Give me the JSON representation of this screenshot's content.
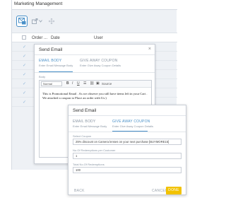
{
  "background": {
    "title": "Marketing Management",
    "table": {
      "columns": [
        "Order ...",
        "Date",
        "User"
      ]
    },
    "row_count": 7
  },
  "dialog1": {
    "title": "Send Email",
    "close": "×",
    "tabs": [
      {
        "label": "EMAIL BODY",
        "sub": "Enter Email Message Body",
        "active": true
      },
      {
        "label": "GIVE AWAY COUPON",
        "sub": "Enter Give Away Coupon Details",
        "active": false
      }
    ],
    "body_label": "Body",
    "editor": {
      "font": "Normal",
      "bold": "B",
      "italic": "I",
      "underline": "U",
      "source": "Source",
      "content": "This is Promotional Email . As we observe you still have items left in your  Cart . We attached a coupon to Place an order with Us:)"
    }
  },
  "dialog2": {
    "title": "Send Email",
    "tabs": [
      {
        "label": "EMAIL BODY",
        "sub": "Enter Email Message Body",
        "active": false
      },
      {
        "label": "GIVE AWAY COUPON",
        "sub": "Enter Give Away Coupon Details",
        "active": true
      }
    ],
    "fields": [
      {
        "label": "Select Coupon",
        "value": "25% discount on Camera lenses on your next purchase [BUYMORE15]"
      },
      {
        "label": "No.Of Redemptions per Customer",
        "value": "1"
      },
      {
        "label": "Total No.Of Redemptions",
        "value": "100"
      }
    ],
    "back": "BACK",
    "cancel": "CANCEL",
    "done": "DONE"
  },
  "colors": {
    "accent": "#4a90c8",
    "done": "#f2c200"
  }
}
